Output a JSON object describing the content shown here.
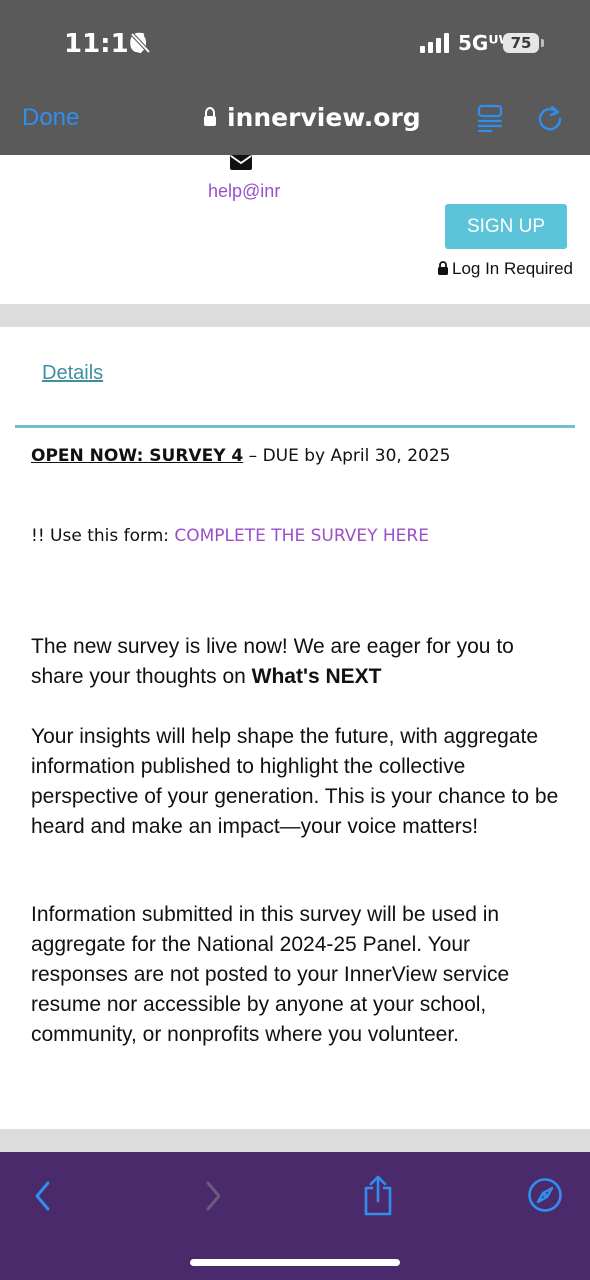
{
  "status_bar": {
    "time": "11:16",
    "network": "5Gᵁᵂ",
    "battery": "75"
  },
  "browser": {
    "done_label": "Done",
    "url": "innerview.org"
  },
  "header": {
    "help_email": "help@inr",
    "signup_label": "SIGN UP",
    "login_required": "Log In Required"
  },
  "nav": {
    "details_label": "Details"
  },
  "survey": {
    "open_now_label": "OPEN NOW: SURVEY 4",
    "due_text": " – DUE by April 30, 2025",
    "use_form_prefix": "!! Use this form: ",
    "form_link": "COMPLETE THE SURVEY HERE"
  },
  "body": {
    "p1_text": "The new survey is live now! We are eager for you to share your thoughts on ",
    "p1_bold": "What's NEXT",
    "p2": "Your insights will help shape the future, with aggregate information published to highlight the collective perspective of your generation. This is your chance to be heard and make an impact—your voice matters!",
    "p3": "Information submitted in this survey will be used in aggregate for the National 2024-25 Panel.  Your responses are not posted to your InnerView service resume nor accessible by anyone at your school, community, or nonprofits where you volunteer."
  },
  "colors": {
    "accent_link": "#9b4fc9",
    "signup_bg": "#5bc4d9",
    "toolbar_bg": "#4a2a6a",
    "browser_blue": "#2f8ff0"
  }
}
